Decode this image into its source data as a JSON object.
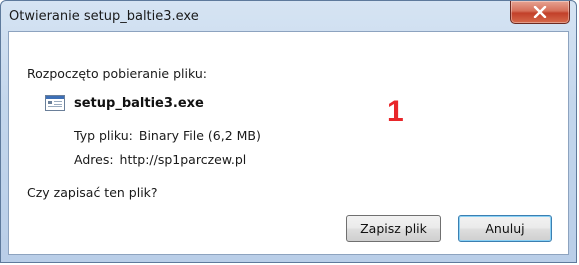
{
  "window": {
    "title": "Otwieranie setup_baltie3.exe"
  },
  "dialog": {
    "intro": "Rozpoczęto pobieranie pliku:",
    "file_name": "setup_baltie3.exe",
    "type_label": "Typ pliku:",
    "type_value": "Binary File (6,2 MB)",
    "address_label": "Adres:",
    "address_value": "http://sp1parczew.pl",
    "question": "Czy zapisać ten plik?",
    "annotation_number": "1"
  },
  "buttons": {
    "save_label": "Zapisz plik",
    "cancel_label": "Anuluj"
  },
  "icons": {
    "close": "close-icon",
    "file": "executable-file-icon"
  },
  "colors": {
    "annotation": "#e8262a",
    "close_button": "#c2402a"
  }
}
